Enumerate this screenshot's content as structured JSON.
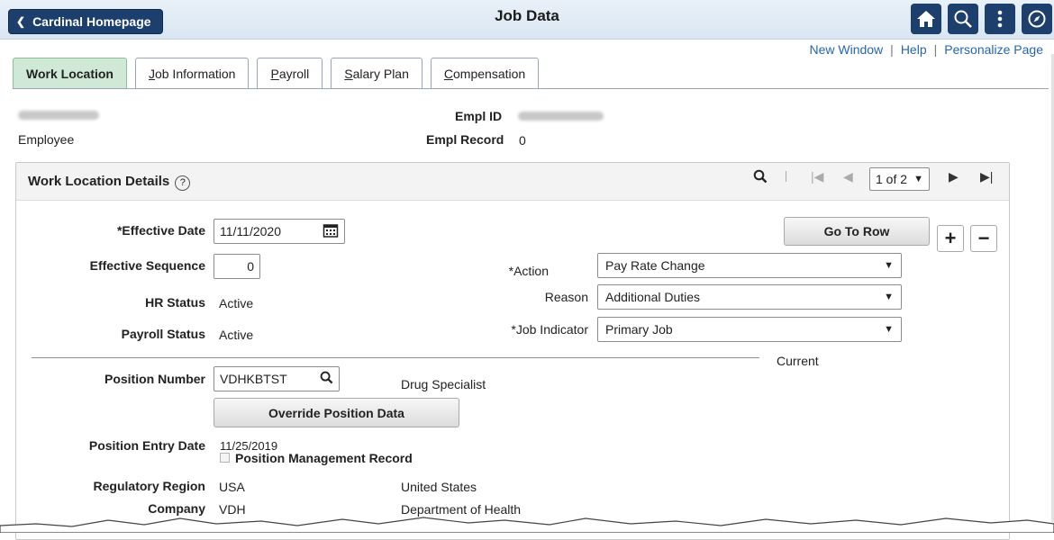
{
  "header": {
    "back_label": "Cardinal Homepage",
    "title": "Job Data",
    "icons": [
      "home-icon",
      "search-icon",
      "more-icon",
      "navigator-icon"
    ]
  },
  "links": {
    "new_window": "New Window",
    "help": "Help",
    "personalize": "Personalize Page"
  },
  "tabs": [
    {
      "accesskey": "",
      "label": "Work Location"
    },
    {
      "accesskey": "J",
      "label": "ob Information"
    },
    {
      "accesskey": "P",
      "label": "ayroll"
    },
    {
      "accesskey": "S",
      "label": "alary Plan"
    },
    {
      "accesskey": "C",
      "label": "ompensation"
    }
  ],
  "employee": {
    "type": "Employee",
    "empl_id_label": "Empl ID",
    "empl_record_label": "Empl Record",
    "empl_record_value": "0"
  },
  "panel": {
    "title": "Work Location Details",
    "help_glyph": "?",
    "pager_count": "1 of 2"
  },
  "form": {
    "effective_date_label": "*Effective Date",
    "effective_date_value": "11/11/2020",
    "effective_sequence_label": "Effective Sequence",
    "effective_sequence_value": "0",
    "hr_status_label": "HR Status",
    "hr_status_value": "Active",
    "payroll_status_label": "Payroll Status",
    "payroll_status_value": "Active",
    "go_to_row": "Go To Row",
    "action_label": "*Action",
    "action_value": "Pay Rate Change",
    "reason_label": "Reason",
    "reason_value": "Additional Duties",
    "job_indicator_label": "*Job Indicator",
    "job_indicator_value": "Primary Job",
    "current_label": "Current",
    "position_number_label": "Position Number",
    "position_number_value": "VDHKBTST",
    "position_desc": "Drug Specialist",
    "override_button": "Override Position Data",
    "position_entry_label": "Position Entry Date",
    "position_entry_value": "11/25/2019",
    "position_mgmt_label": "Position Management Record",
    "reg_region_label": "Regulatory Region",
    "reg_region_value": "USA",
    "reg_region_desc": "United States",
    "company_label": "Company",
    "company_value": "VDH",
    "company_desc": "Department of Health"
  },
  "colors": {
    "nav_blue": "#1d3f6e",
    "active_tab": "#cfe9d6",
    "link_blue": "#2566b0"
  }
}
